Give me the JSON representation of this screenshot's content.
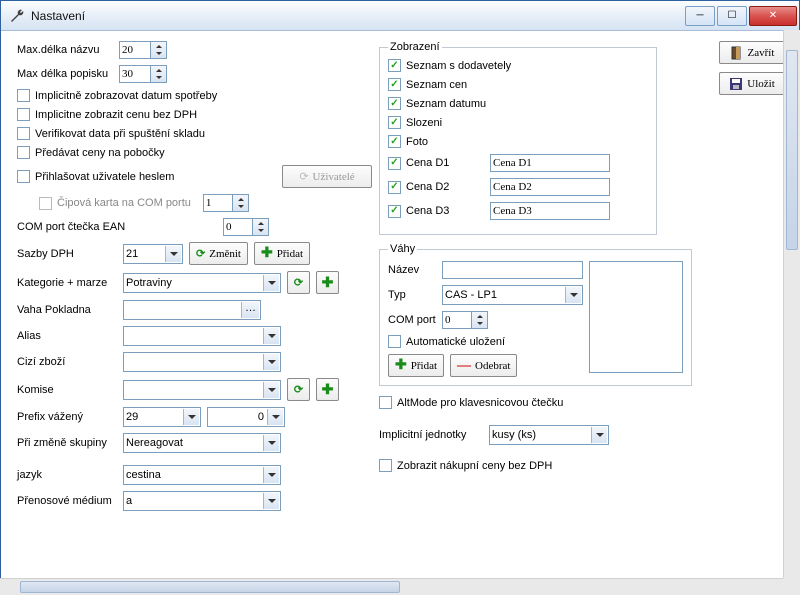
{
  "window": {
    "title": "Nastavení"
  },
  "left": {
    "maxNameLen": {
      "label": "Max.délka názvu",
      "value": "20"
    },
    "maxDescLen": {
      "label": "Max délka popisku",
      "value": "30"
    },
    "implicitDate": "Implicitně zobrazovat datum spotřeby",
    "implicitPriceNoVat": "Implicitne zobrazit cenu  bez DPH",
    "verifyData": "Verifikovat data při spuštění skladu",
    "transferPrices": "Předávat ceny na pobočky",
    "loginPassword": "Přihlašovat uživatele heslem",
    "usersBtn": "Uživatelé",
    "chipCard": {
      "label": "Čipová karta na COM portu",
      "value": "1"
    },
    "comEan": {
      "label": "COM port čtečka EAN",
      "value": "0"
    },
    "vatRates": {
      "label": "Sazby DPH",
      "value": "21",
      "changeBtn": "Změnit",
      "addBtn": "Přidat"
    },
    "category": {
      "label": "Kategorie + marze",
      "value": "Potraviny"
    },
    "scaleLabel": "Vaha Pokladna",
    "aliasLabel": "Alias",
    "foreignLabel": "Cizí zboží",
    "comissionLabel": "Komise",
    "prefixWeighed": {
      "label": "Prefix vážený",
      "v1": "29",
      "v2": "0"
    },
    "onGroupChange": {
      "label": "Při změně skupiny",
      "value": "Nereagovat"
    },
    "language": {
      "label": "jazyk",
      "value": "cestina"
    },
    "transferMedium": {
      "label": "Přenosové médium",
      "value": "a"
    }
  },
  "view": {
    "legend": "Zobrazení",
    "listSuppliers": "Seznam s dodavetely",
    "listPrices": "Seznam cen",
    "listDates": "Seznam datumu",
    "composition": "Slozeni",
    "photo": "Foto",
    "priceD1": {
      "label": "Cena D1",
      "value": "Cena D1"
    },
    "priceD2": {
      "label": "Cena D2",
      "value": "Cena D2"
    },
    "priceD3": {
      "label": "Cena D3",
      "value": "Cena D3"
    }
  },
  "scales": {
    "legend": "Váhy",
    "nameLabel": "Název",
    "typeLabel": "Typ",
    "typeValue": "CAS - LP1",
    "comPortLabel": "COM port",
    "comPortValue": "0",
    "autoSave": "Automatické uložení",
    "addBtn": "Přidat",
    "removeBtn": "Odebrat"
  },
  "altMode": "AltMode pro klavesnicovou čtečku",
  "units": {
    "label": "Implicitní jednotky",
    "value": "kusy         (ks)"
  },
  "showBuyNoVat": "Zobrazit nákupní ceny bez DPH",
  "closeBtn": "Zavřít",
  "saveBtn": "Uložit"
}
